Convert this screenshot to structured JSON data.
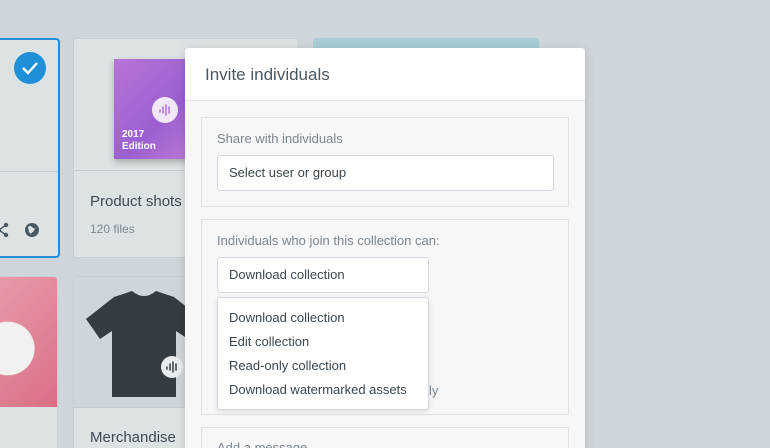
{
  "background": {
    "cards": [
      {
        "title": "",
        "subtitle": ""
      },
      {
        "title": "Product shots",
        "subtitle": "120 files",
        "album_text_line1": "2017",
        "album_text_line2": "Edition"
      },
      {
        "title": "",
        "subtitle": ""
      },
      {
        "title": "",
        "subtitle": ""
      },
      {
        "title": "Merchandise",
        "subtitle": ""
      }
    ],
    "icons": [
      "check-icon",
      "share-icon",
      "globe-icon",
      "brand-logo-icon"
    ],
    "accent": "#1f8fd8"
  },
  "modal": {
    "title": "Invite individuals",
    "share_section": {
      "label": "Share with individuals",
      "input_value": "Select user or group"
    },
    "permission_section": {
      "label": "Individuals who join this collection can:",
      "selected": "Download collection",
      "options": [
        "Download collection",
        "Edit collection",
        "Read-only collection",
        "Download watermarked assets"
      ],
      "partial_text": "ly"
    },
    "message_section": {
      "label": "Add a message"
    }
  }
}
